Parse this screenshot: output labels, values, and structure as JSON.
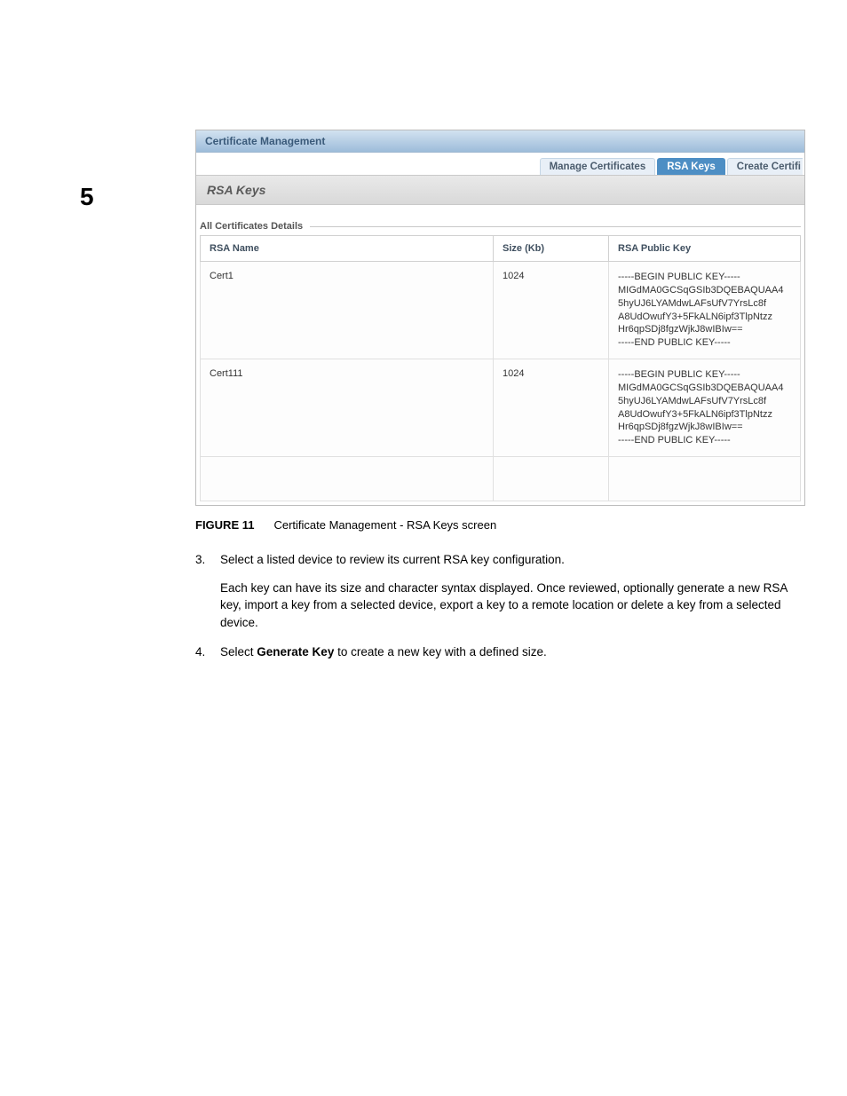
{
  "page_number": "5",
  "panel_title": "Certificate Management",
  "tabs": [
    "Manage Certificates",
    "RSA Keys",
    "Create Certifi"
  ],
  "active_tab_index": 1,
  "subheader": "RSA Keys",
  "fieldset_legend": "All Certificates Details",
  "columns": [
    "RSA Name",
    "Size (Kb)",
    "RSA Public Key"
  ],
  "rows": [
    {
      "name": "Cert1",
      "size": "1024",
      "pk": "-----BEGIN PUBLIC KEY-----\nMIGdMA0GCSqGSIb3DQEBAQUAA4\n5hyUJ6LYAMdwLAFsUfV7YrsLc8f\nA8UdOwufY3+5FkALN6ipf3TlpNtzz\nHr6qpSDj8fgzWjkJ8wIBIw==\n-----END PUBLIC KEY-----"
    },
    {
      "name": "Cert111",
      "size": "1024",
      "pk": "-----BEGIN PUBLIC KEY-----\nMIGdMA0GCSqGSIb3DQEBAQUAA4\n5hyUJ6LYAMdwLAFsUfV7YrsLc8f\nA8UdOwufY3+5FkALN6ipf3TlpNtzz\nHr6qpSDj8fgzWjkJ8wIBIw==\n-----END PUBLIC KEY-----"
    }
  ],
  "figure_label": "FIGURE 11",
  "figure_caption": "Certificate Management - RSA Keys screen",
  "step3_num": "3.",
  "step3_text": "Select a listed device to review its current RSA key configuration.",
  "step3_para": "Each key can have its size and character syntax displayed. Once reviewed, optionally generate a new RSA key, import a key from a selected device, export a key to a remote location or delete a key from a selected device.",
  "step4_num": "4.",
  "step4_prefix": "Select ",
  "step4_bold": "Generate Key",
  "step4_suffix": " to create a new key with a defined size."
}
